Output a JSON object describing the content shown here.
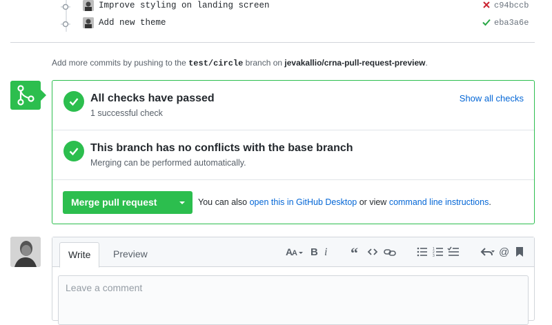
{
  "commits": [
    {
      "message": "Improve styling on landing screen",
      "status": "failure",
      "sha": "c94bccb"
    },
    {
      "message": "Add new theme",
      "status": "success",
      "sha": "eba3a6e"
    }
  ],
  "push_hint": {
    "prefix": "Add more commits by pushing to the",
    "branch": "test/circle",
    "middle": "branch on",
    "repo": "jevakallio/crna-pull-request-preview",
    "suffix": "."
  },
  "merge_box": {
    "checks": {
      "title": "All checks have passed",
      "subtitle": "1 successful check",
      "link": "Show all checks"
    },
    "conflicts": {
      "title": "This branch has no conflicts with the base branch",
      "subtitle": "Merging can be performed automatically."
    },
    "merge_button": "Merge pull request",
    "alt_prefix": "You can also",
    "alt_link1": "open this in GitHub Desktop",
    "alt_middle": "or view",
    "alt_link2": "command line instructions",
    "alt_suffix": "."
  },
  "comment": {
    "tabs": [
      "Write",
      "Preview"
    ],
    "placeholder": "Leave a comment",
    "toolbar": [
      "text-size-icon",
      "bold-icon",
      "italic-icon",
      "quote-icon",
      "code-icon",
      "link-icon",
      "bulleted-list-icon",
      "numbered-list-icon",
      "task-list-icon",
      "reply-icon",
      "mention-icon",
      "bookmark-icon"
    ]
  },
  "colors": {
    "success": "#2cbe4e",
    "failure": "#cb2431",
    "link": "#0366d6"
  }
}
